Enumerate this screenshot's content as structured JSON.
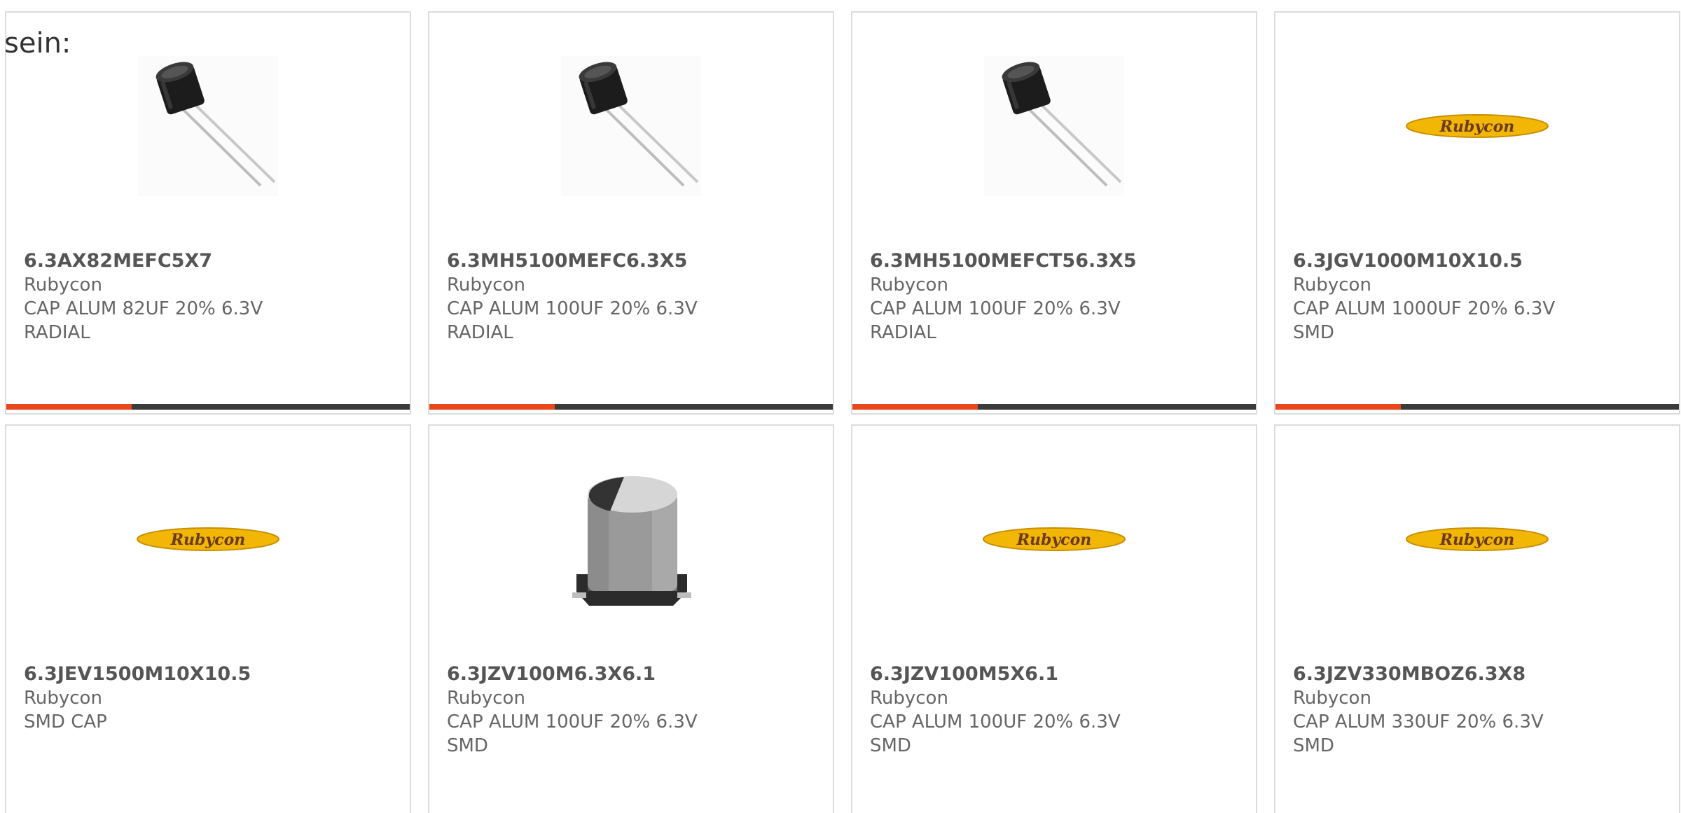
{
  "intro_text": "sein:",
  "colors": {
    "accent": "#e8471c",
    "bar_track": "#3b3b3b",
    "logo_fill": "#f2b705",
    "logo_text": "#6b3a1f"
  },
  "products": [
    {
      "part": "6.3AX82MEFC5X7",
      "manufacturer": "Rubycon",
      "description": "CAP ALUM 82UF 20% 6.3V RADIAL",
      "image": "radial-capacitor-icon",
      "progress": 0.31
    },
    {
      "part": "6.3MH5100MEFC6.3X5",
      "manufacturer": "Rubycon",
      "description": "CAP ALUM 100UF 20% 6.3V RADIAL",
      "image": "radial-capacitor-icon",
      "progress": 0.31
    },
    {
      "part": "6.3MH5100MEFCT56.3X5",
      "manufacturer": "Rubycon",
      "description": "CAP ALUM 100UF 20% 6.3V RADIAL",
      "image": "radial-capacitor-icon",
      "progress": 0.31
    },
    {
      "part": "6.3JGV1000M10X10.5",
      "manufacturer": "Rubycon",
      "description": "CAP ALUM 1000UF 20% 6.3V SMD",
      "image": "rubycon-logo",
      "logo_text": "Rubycon",
      "progress": 0.31
    },
    {
      "part": "6.3JEV1500M10X10.5",
      "manufacturer": "Rubycon",
      "description": "SMD CAP",
      "image": "rubycon-logo",
      "logo_text": "Rubycon"
    },
    {
      "part": "6.3JZV100M6.3X6.1",
      "manufacturer": "Rubycon",
      "description": "CAP ALUM 100UF 20% 6.3V SMD",
      "image": "smd-capacitor-icon"
    },
    {
      "part": "6.3JZV100M5X6.1",
      "manufacturer": "Rubycon",
      "description": "CAP ALUM 100UF 20% 6.3V SMD",
      "image": "rubycon-logo",
      "logo_text": "Rubycon"
    },
    {
      "part": "6.3JZV330MBOZ6.3X8",
      "manufacturer": "Rubycon",
      "description": "CAP ALUM 330UF 20% 6.3V SMD",
      "image": "rubycon-logo",
      "logo_text": "Rubycon"
    }
  ]
}
